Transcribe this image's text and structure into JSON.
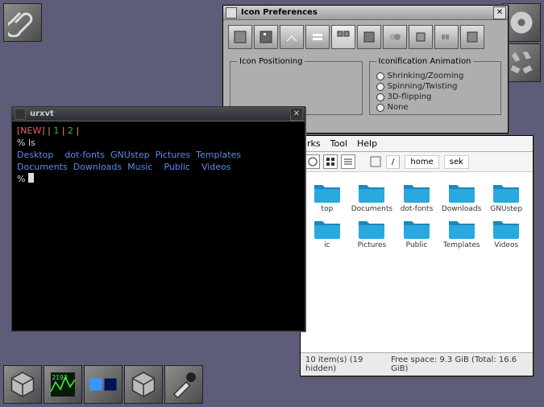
{
  "iconprefs": {
    "title": "Icon Preferences",
    "positioning_legend": "Icon Positioning",
    "animation_legend": "Iconification Animation",
    "animation_options": [
      "Shrinking/Zooming",
      "Spinning/Twisting",
      "3D-flipping",
      "None"
    ]
  },
  "urxvt": {
    "title": "urxvt",
    "prompt": "%",
    "line1_left": "[NEW]",
    "line1_mid": " | ",
    "line1_a": "1",
    "line1_b": "2",
    "line1_end": " |",
    "cmd": "ls",
    "row1": [
      "Desktop",
      "dot-fonts",
      "GNUstep",
      "Pictures",
      "Templates"
    ],
    "row2": [
      "Documents",
      "Downloads",
      "Music",
      "Public",
      "Videos"
    ]
  },
  "gwork": {
    "menus": [
      "rks",
      "Tool",
      "Help"
    ],
    "crumbs": [
      "/",
      "home",
      "sek"
    ],
    "folders": [
      {
        "label": "top",
        "partial": true
      },
      {
        "label": "Documents"
      },
      {
        "label": "dot-fonts"
      },
      {
        "label": "Downloads"
      },
      {
        "label": "GNUstep"
      },
      {
        "label": "ic",
        "partial": true
      },
      {
        "label": "Pictures"
      },
      {
        "label": "Public"
      },
      {
        "label": "Templates"
      },
      {
        "label": "Videos"
      }
    ],
    "status_left": "10 item(s) (19 hidden)",
    "status_right": "Free space: 9.3 GiB (Total: 16.6 GiB)"
  }
}
